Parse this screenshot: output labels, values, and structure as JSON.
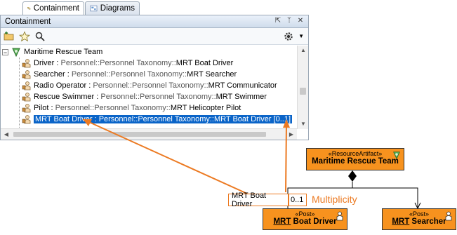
{
  "tabs": [
    {
      "label": "Containment",
      "icon": "containment-tab-icon",
      "active": true
    },
    {
      "label": "Diagrams",
      "icon": "diagrams-tab-icon",
      "active": false
    }
  ],
  "panel": {
    "title": "Containment",
    "header_buttons": [
      "restore-icon",
      "pin-icon",
      "close-icon"
    ],
    "toolbar": [
      "add-folder-icon",
      "star-icon",
      "search-icon",
      "settings-gear-icon",
      "dropdown-arrow-icon"
    ]
  },
  "tree": {
    "root": "Maritime Rescue Team",
    "items": [
      {
        "name": "Driver",
        "sep": " : ",
        "type": "Personnel::Personnel Taxonomy::",
        "class": "MRT Boat Driver",
        "suffix": ""
      },
      {
        "name": "Searcher",
        "sep": " : ",
        "type": "Personnel::Personnel Taxonomy::",
        "class": "MRT Searcher",
        "suffix": ""
      },
      {
        "name": "Radio Operator",
        "sep": " : ",
        "type": "Personnel::Personnel Taxonomy::",
        "class": "MRT Communicator",
        "suffix": ""
      },
      {
        "name": "Rescue Swimmer",
        "sep": " : ",
        "type": "Personnel::Personnel Taxonomy::",
        "class": "MRT Swimmer",
        "suffix": ""
      },
      {
        "name": "Pilot",
        "sep": " : ",
        "type": "Personnel::Personnel Taxonomy::",
        "class": "MRT Helicopter Pilot",
        "suffix": ""
      },
      {
        "name": "MRT Boat Driver",
        "sep": " : ",
        "type": "Personnel::Personnel Taxonomy::",
        "class": "MRT Boat Driver",
        "suffix": " [0..1]"
      }
    ],
    "selected_index": 5
  },
  "diagram": {
    "resource": {
      "stereotype": "«ResourceArtifact»",
      "name": "Maritime Rescue Team"
    },
    "post1": {
      "stereotype": "«Post»",
      "prefix": "MRT",
      "rest": " Boat Driver"
    },
    "post2": {
      "stereotype": "«Post»",
      "prefix": "MRT",
      "rest": " Searcher"
    },
    "role_label": "MRT Boat Driver",
    "multiplicity_value": "0..1",
    "annotation": "Multiplicity"
  },
  "colors": {
    "accent": "#ec7a22",
    "selection": "#0a64c8",
    "box_fill": "#f7921e"
  }
}
